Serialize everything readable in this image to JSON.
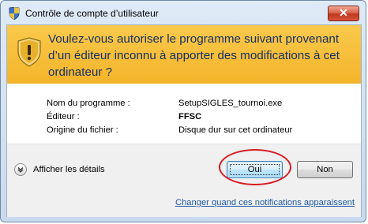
{
  "window": {
    "title": "Contrôle de compte d’utilisateur",
    "close_label": "✕"
  },
  "banner": {
    "message": "Voulez-vous autoriser le programme suivant provenant d’un éditeur inconnu à apporter des modifications à cet ordinateur ?",
    "icon": "shield-warning-icon"
  },
  "details": [
    {
      "label": "Nom du programme :",
      "value": "SetupSIGLES_tournoi.exe",
      "bold": false
    },
    {
      "label": "Éditeur :",
      "value": "FFSC",
      "bold": true
    },
    {
      "label": "Origine du fichier :",
      "value": "Disque dur sur cet ordinateur",
      "bold": false
    }
  ],
  "footer": {
    "expander_label": "Afficher les détails",
    "yes_label": "Oui",
    "no_label": "Non",
    "link_text": "Changer quand ces notifications apparaissent"
  },
  "colors": {
    "banner": "#f6bb34",
    "banner_text": "#152f63",
    "highlight_ring": "#d71a21",
    "link": "#1f5ba8"
  }
}
